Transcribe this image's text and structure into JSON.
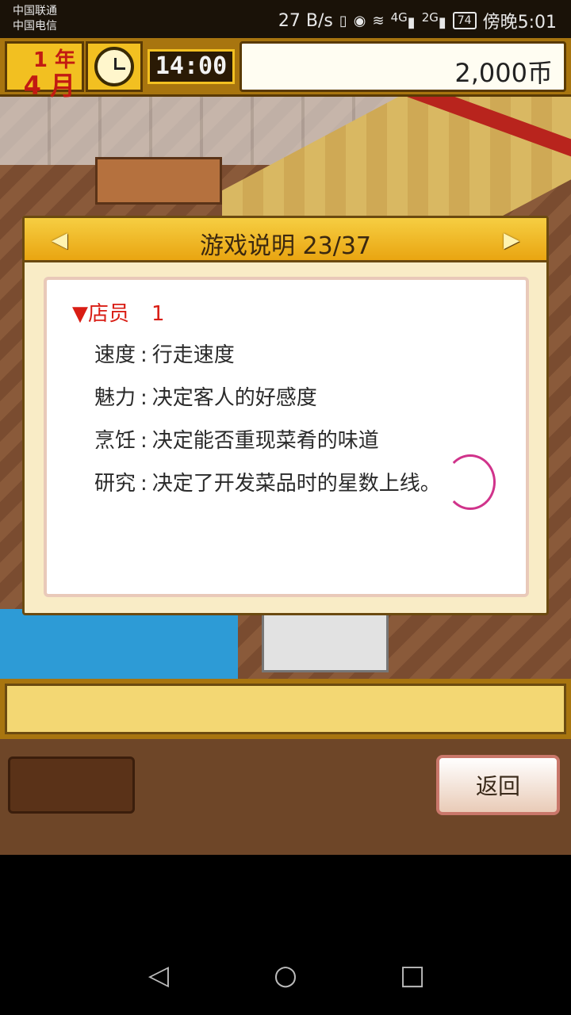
{
  "status_bar": {
    "carrier_1": "中国联通",
    "carrier_2": "中国电信",
    "speed": "27 B/s",
    "network_1": "4G",
    "network_2": "2G",
    "battery": "74",
    "time": "傍晚5:01"
  },
  "hud": {
    "year_label": "1 年",
    "month_label": "4 月",
    "clock_time": "14:00",
    "money": "2,000币"
  },
  "dialog": {
    "title": "游戏说明 23/37",
    "heading_marker": "▼",
    "heading_label": "店员",
    "heading_number": "1",
    "rows": [
      {
        "label": "速度",
        "separator": ":",
        "value": "行走速度"
      },
      {
        "label": "魅力",
        "separator": ":",
        "value": "决定客人的好感度"
      },
      {
        "label": "烹饪",
        "separator": ":",
        "value": "决定能否重现菜肴的味道"
      },
      {
        "label": "研究",
        "separator": ":",
        "value": "决定了开发菜品时的星数上线。"
      }
    ]
  },
  "footer": {
    "back_label": "返回"
  },
  "colors": {
    "heading": "#d91d14",
    "dialog_header": "#f6ce42",
    "annotation": "#d0338b"
  },
  "icons": {
    "prev": "chevron-left-icon",
    "next": "chevron-right-icon",
    "nav_back": "triangle-back-icon",
    "nav_home": "circle-home-icon",
    "nav_recent": "square-recent-icon"
  }
}
